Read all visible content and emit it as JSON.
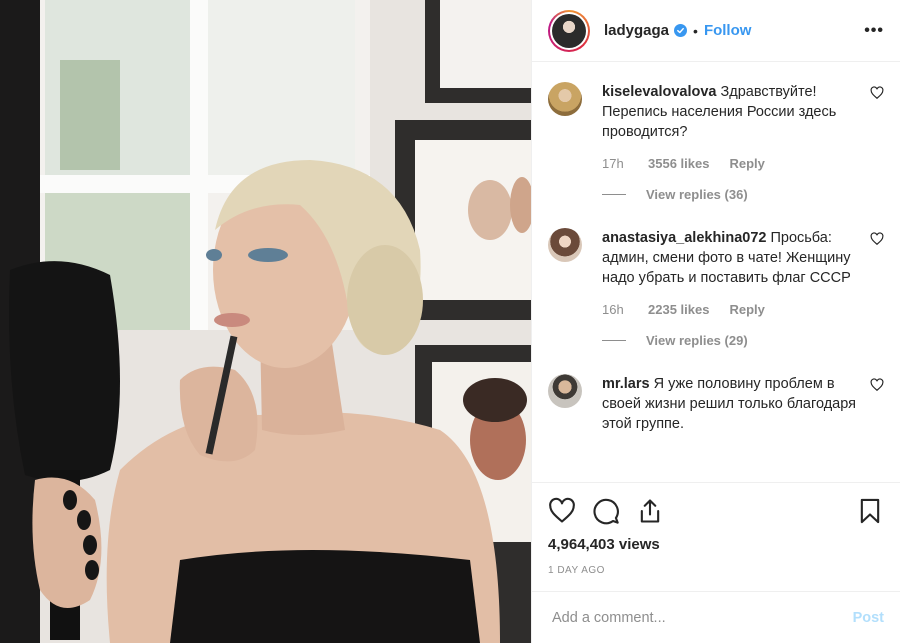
{
  "post": {
    "username": "ladygaga",
    "verified": true,
    "follow_label": "Follow",
    "more_label": "•••"
  },
  "comments": [
    {
      "username": "kiselevalovalova",
      "text": "Здравствуйте! Перепись населения России здесь проводится?",
      "time": "17h",
      "likes": "3556 likes",
      "reply_label": "Reply",
      "view_replies": "View replies (36)"
    },
    {
      "username": "anastasiya_alekhina072",
      "text": "Просьба: админ, смени фото в чате! Женщину надо убрать и поставить флаг СССР",
      "time": "16h",
      "likes": "2235 likes",
      "reply_label": "Reply",
      "view_replies": "View replies (29)"
    },
    {
      "username": "mr.lars",
      "text": "Я уже половину проблем в своей жизни решил только благодаря этой группе.",
      "time": "",
      "likes": "",
      "reply_label": "",
      "view_replies": ""
    }
  ],
  "stats": {
    "views": "4,964,403 views",
    "age": "1 DAY AGO"
  },
  "composer": {
    "placeholder": "Add a comment...",
    "post_label": "Post"
  },
  "colors": {
    "accent": "#3897f0",
    "post_disabled": "#b2dffc",
    "meta": "#8e8e8e"
  },
  "icons": [
    "verified-badge-icon",
    "heart-icon",
    "comment-icon",
    "share-icon",
    "bookmark-icon",
    "more-icon"
  ]
}
